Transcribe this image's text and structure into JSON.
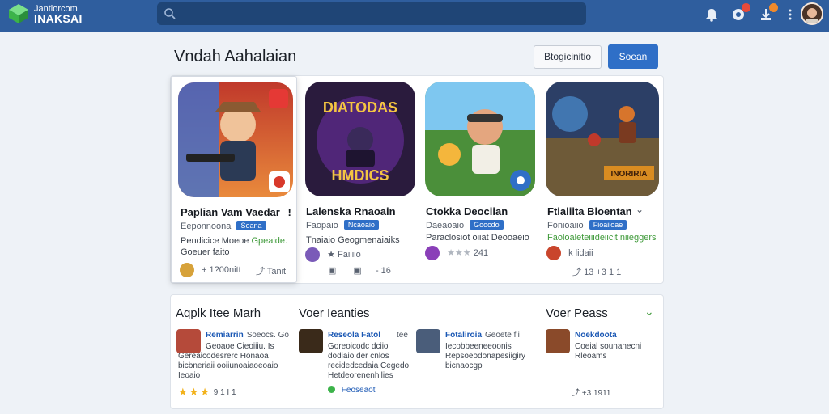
{
  "header": {
    "brand_line1": "Jantiorcom",
    "brand_line2": "INAKSAI",
    "search_placeholder": "",
    "notif_badge_1": "",
    "notif_badge_2": "",
    "colors": {
      "bar": "#2f5e9e",
      "accent": "#2f6fc7"
    }
  },
  "main": {
    "title": "Vndah Aahalaian",
    "secondary_button": "Btogicinitio",
    "primary_button": "Soean"
  },
  "cards": [
    {
      "title": "Paplian Vam Vaedar",
      "extra": "!",
      "meta": "Eeponnoona",
      "tag": "Soana",
      "desc_a": "Pendicice Moeoe",
      "desc_b": "Gpeaide.",
      "desc_line2": "Goeuer faito",
      "foot_left": "+ 1?00nitt",
      "foot_right": "Tanit"
    },
    {
      "title": "Lalenska Rnaoain",
      "meta": "Faopaio",
      "tag": "Ncaoaio",
      "desc": "Tnaiaio Geogmenaiaiks",
      "foot_left": "Faiiiio",
      "foot_right": "- 16",
      "art_top": "DIATODAS",
      "art_bottom": "HMDICS"
    },
    {
      "title": "Ctokka Deociian",
      "meta": "Daeaoaio",
      "tag": "Goocdo",
      "desc": "Paraclosiot oiiat Deooaeio",
      "foot": "241"
    },
    {
      "title": "Ftialiita Bloentan",
      "meta": "Fonioaiio",
      "tag": "Fioaiioae",
      "desc": "Faoloaleteiiideiicit niieggers",
      "foot_left": "k lidaii",
      "foot_right": "13 +3 1 1",
      "art_label": "INORIRIA"
    }
  ],
  "panel": {
    "sections": [
      "Aqplk Itee Marh",
      "Voer Ieanties",
      "Voer Peass"
    ],
    "apps": [
      {
        "name": "Remiarrin",
        "name_extra": "Soeocs. Go",
        "desc": [
          "Geoaoe Cieoiiiu. Is",
          "Gereaicodesrerc Honaoa",
          "bicbneriaii ooiiunoaiaoeoaio",
          "Ieoaio"
        ],
        "foot": "9 1 I 1"
      },
      {
        "name": "Reseola Fatol",
        "name_extra": "tee",
        "desc": [
          "Goreoicodc dciio",
          "dodiaio der cnlos",
          "recidedcedaia Cegedo",
          "Hetdeorenenhilies"
        ],
        "foot": "Feoseaot"
      },
      {
        "name": "Fotaliroia",
        "name_extra": "Geoete  fli",
        "desc": [
          "Iecobbeeneeoonis",
          "Repsoeodonapesiigiry",
          "bicnaocgp"
        ]
      },
      {
        "name": "Noekdoota",
        "desc": [
          "Coeial sounanecni",
          "Rleoams"
        ],
        "foot": "+3 1911"
      }
    ]
  }
}
